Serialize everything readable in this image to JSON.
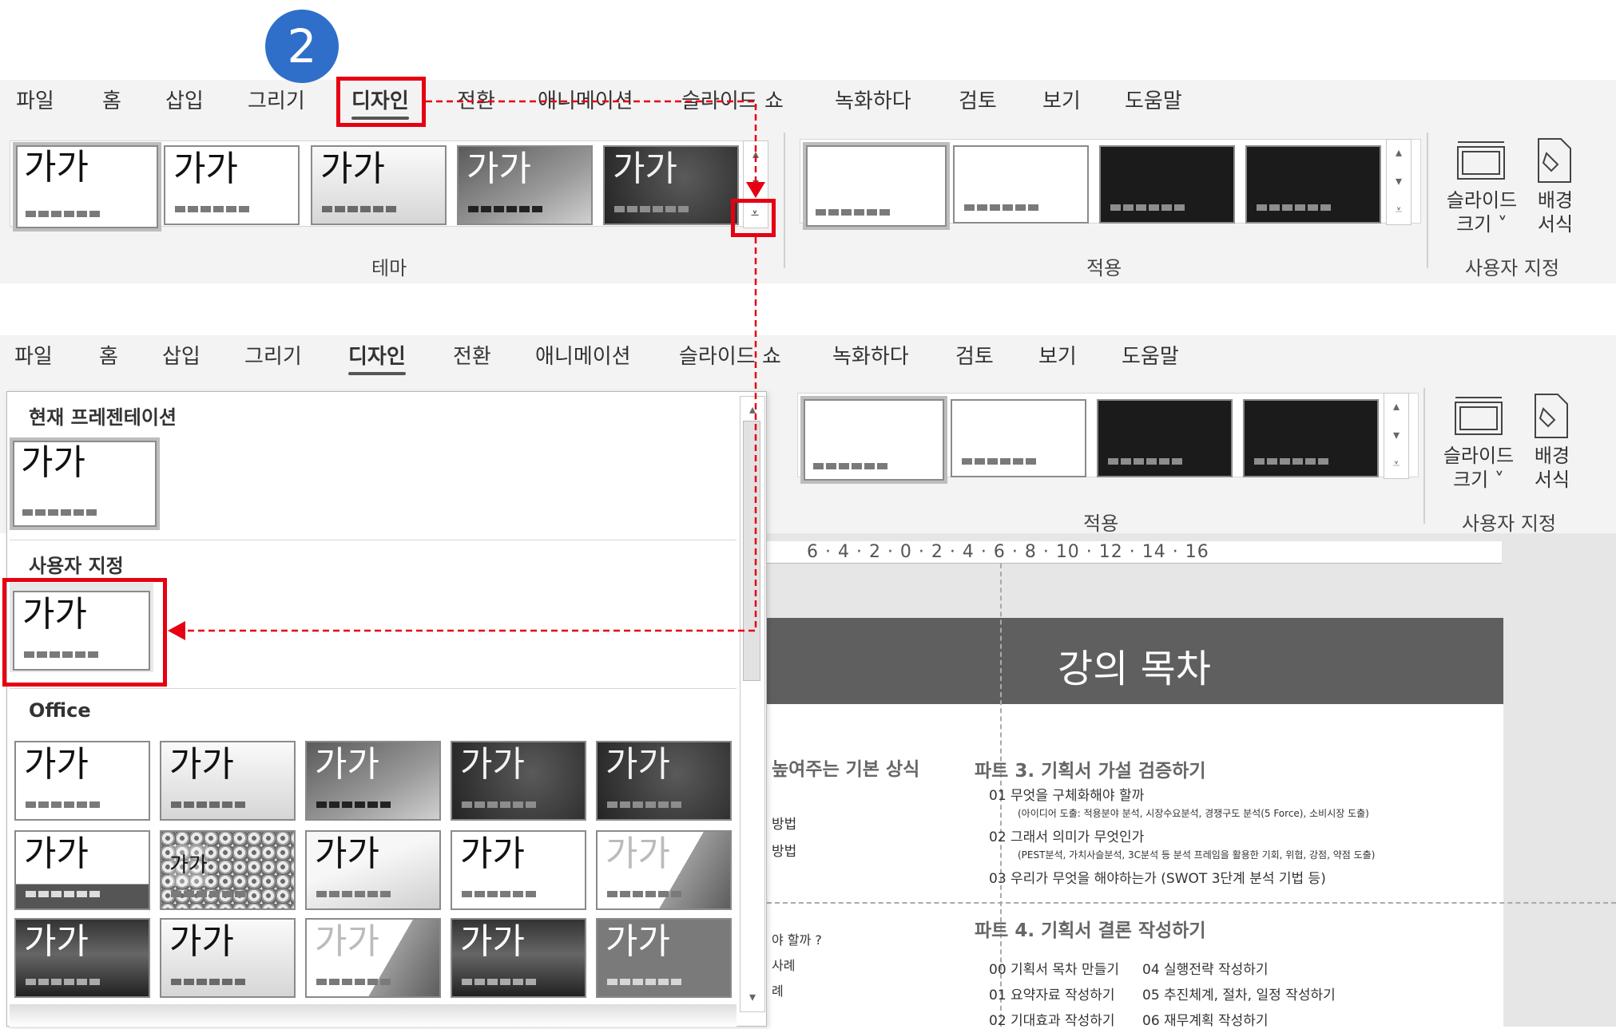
{
  "step_badge": "2",
  "tabs": [
    "파일",
    "홈",
    "삽입",
    "그리기",
    "디자인",
    "전환",
    "애니메이션",
    "슬라이드 쇼",
    "녹화하다",
    "검토",
    "보기",
    "도움말"
  ],
  "active_tab": "디자인",
  "theme_thumb_text": "가가",
  "groups": {
    "theme": "테마",
    "variants": "적용",
    "customize": "사용자 지정"
  },
  "buttons": {
    "slide_size": [
      "슬라이드",
      "크기 ˅"
    ],
    "format_background": [
      "배경",
      "서식"
    ]
  },
  "dropdown": {
    "sections": {
      "current": "현재 프레젠테이션",
      "custom": "사용자 지정",
      "office": "Office"
    }
  },
  "slide": {
    "title": "강의 목차",
    "ruler": "6 · 4 · 2 · 0 · 2 · 4 · 6 · 8 · 10 · 12 · 14 · 16",
    "left_col": [
      "높여주는 기본 상식",
      "방법",
      "방법",
      "야 할까 ?",
      "사례",
      "례"
    ],
    "part3": {
      "title": "파트 3. 기획서 가설 검증하기",
      "items": [
        "01  무엇을 구체화해야 할까",
        "(아이디어 도출: 적용분야 분석, 시장수요분석, 경쟁구도 분석(5 Force), 소비시장 도출)",
        "02 그래서 의미가 무엇인가",
        "(PEST분석, 가치사슬분석, 3C분석 등 분석 프레임을 활용한 기회, 위협, 강점, 약점 도출)",
        "03 우리가 무엇을 해야하는가 (SWOT 3단계 분석 기법 등)"
      ]
    },
    "part4": {
      "title": "파트 4. 기획서 결론 작성하기",
      "col1": [
        "00 기획서 목차 만들기",
        "01 요약자료 작성하기",
        "02 기대효과 작성하기"
      ],
      "col2": [
        "04 실행전략 작성하기",
        "05 추진체계, 절차, 일정 작성하기",
        "06 재무계획 작성하기"
      ]
    }
  },
  "colors": {
    "highlight": "#e60012",
    "badge": "#2f6fc9",
    "slide_header": "#5f5f5f"
  }
}
